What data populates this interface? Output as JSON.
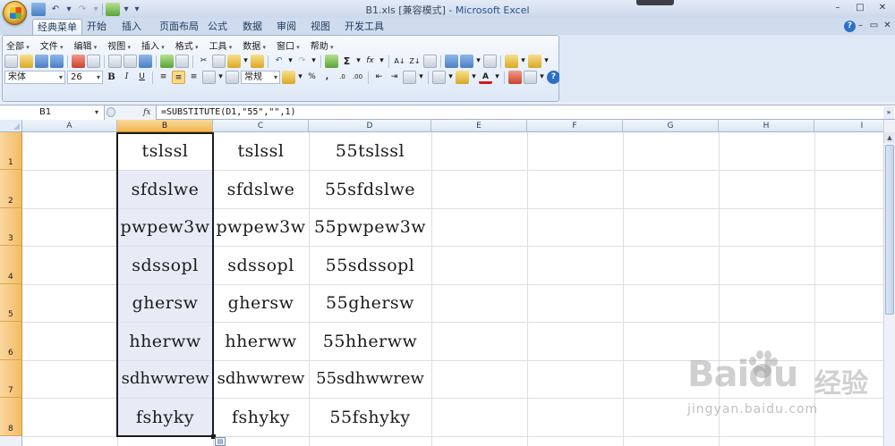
{
  "window": {
    "title": "B1.xls  [兼容模式] - ",
    "app_name": "Microsoft Excel",
    "controls": [
      "–",
      "□",
      "✕"
    ]
  },
  "ribbon_tabs": [
    {
      "label": "经典菜单",
      "active": true
    },
    {
      "label": "开始",
      "active": false
    },
    {
      "label": "插入",
      "active": false
    },
    {
      "label": "页面布局",
      "active": false
    },
    {
      "label": "公式",
      "active": false
    },
    {
      "label": "数据",
      "active": false
    },
    {
      "label": "审阅",
      "active": false
    },
    {
      "label": "视图",
      "active": false
    },
    {
      "label": "开发工具",
      "active": false
    }
  ],
  "classic_menu": [
    "全部",
    "文件",
    "编辑",
    "视图",
    "插入",
    "格式",
    "工具",
    "数据",
    "窗口",
    "帮助"
  ],
  "toolbar": {
    "font_name": "宋体",
    "font_size": "26",
    "number_format": "常规",
    "bold": "B",
    "italic": "I",
    "underline": "U",
    "sum": "Σ",
    "fx": "fx",
    "percent": "%",
    "comma": ",",
    "dec_inc": ".0",
    "dec_dec": ".00"
  },
  "formula_bar": {
    "name_box": "B1",
    "fx_label": "fx",
    "formula": "=SUBSTITUTE(D1,\"55\",\"\",1)"
  },
  "columns": [
    "A",
    "B",
    "C",
    "D",
    "E",
    "F",
    "G",
    "H",
    "I"
  ],
  "selected_column": "B",
  "rows": [
    "1",
    "2",
    "3",
    "4",
    "5",
    "6",
    "7",
    "8"
  ],
  "cells": {
    "B": [
      "tslssl",
      "sfdslwe",
      "pwpew3w",
      "sdssopl",
      "ghersw",
      "hherww",
      "sdhwwrew",
      "fshyky"
    ],
    "C": [
      "tslssl",
      "sfdslwe",
      "pwpew3w",
      "sdssopl",
      "ghersw",
      "hherww",
      "sdhwwrew",
      "fshyky"
    ],
    "D": [
      "55tslssl",
      "55sfdslwe",
      "55pwpew3w",
      "55sdssopl",
      "55ghersw",
      "55hherww",
      "55sdhwwrew",
      "55fshyky"
    ]
  },
  "watermark": {
    "logo": "Baidu",
    "cn": "经验",
    "url": "jingyan.baidu.com"
  }
}
